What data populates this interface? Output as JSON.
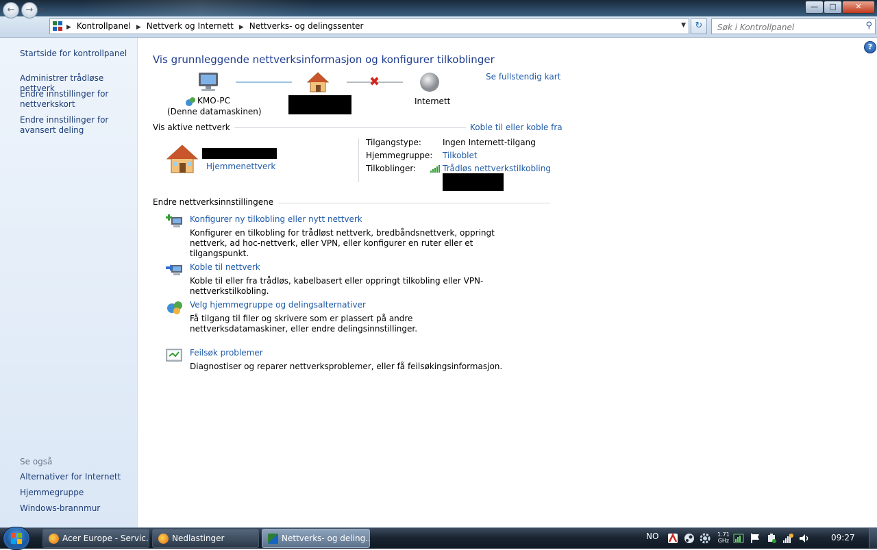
{
  "address": {
    "crumbs": [
      "Kontrollpanel",
      "Nettverk og Internett",
      "Nettverks- og delingssenter"
    ],
    "search_placeholder": "Søk i Kontrollpanel"
  },
  "leftpane": {
    "home_link": "Startside for kontrollpanel",
    "tasks": [
      "Administrer trådløse nettverk",
      "Endre innstillinger for nettverkskort",
      "Endre innstillinger for avansert deling"
    ],
    "see_also_title": "Se også",
    "see_also": [
      "Alternativer for Internett",
      "Hjemmegruppe",
      "Windows-brannmur"
    ]
  },
  "main": {
    "title": "Vis grunnleggende nettverksinformasjon og konfigurer tilkoblinger",
    "full_map_link": "Se fullstendig kart",
    "map": {
      "computer_name": "KMO-PC",
      "computer_caption": "(Denne datamaskinen)",
      "internet_label": "Internett"
    },
    "active": {
      "section_title": "Vis aktive nettverk",
      "connect_link": "Koble til eller koble fra",
      "network_type": "Hjemmenettverk",
      "access_type_label": "Tilgangstype:",
      "access_type_value": "Ingen Internett-tilgang",
      "homegroup_label": "Hjemmegruppe:",
      "homegroup_value": "Tilkoblet",
      "connections_label": "Tilkoblinger:",
      "connections_value": "Trådløs nettverkstilkobling"
    },
    "change": {
      "section_title": "Endre nettverksinnstillingene",
      "tasks": [
        {
          "link": "Konfigurer ny tilkobling eller nytt nettverk",
          "desc": "Konfigurer en tilkobling for trådløst nettverk, bredbåndsnettverk, oppringt nettverk, ad hoc-nettverk, eller VPN, eller konfigurer en ruter eller et tilgangspunkt."
        },
        {
          "link": "Koble til nettverk",
          "desc": "Koble til eller fra trådløs, kabelbasert eller oppringt tilkobling eller VPN-nettverkstilkobling."
        },
        {
          "link": "Velg hjemmegruppe og delingsalternativer",
          "desc": "Få tilgang til filer og skrivere som er plassert på andre nettverksdatamaskiner, eller endre delingsinnstillinger."
        },
        {
          "link": "Feilsøk problemer",
          "desc": "Diagnostiser og reparer nettverksproblemer, eller få feilsøkingsinformasjon."
        }
      ]
    }
  },
  "taskbar": {
    "items": [
      "Acer Europe - Servic...",
      "Nedlastinger",
      "Nettverks- og deling..."
    ],
    "lang": "NO",
    "cpu_freq": "1.71",
    "cpu_unit": "GHz",
    "clock": "09:27"
  },
  "colors": {
    "link": "#1e5aa8",
    "title": "#1e3d8f",
    "leftpane_bg": "#dbe7f6",
    "taskbar": "#1a2532"
  }
}
